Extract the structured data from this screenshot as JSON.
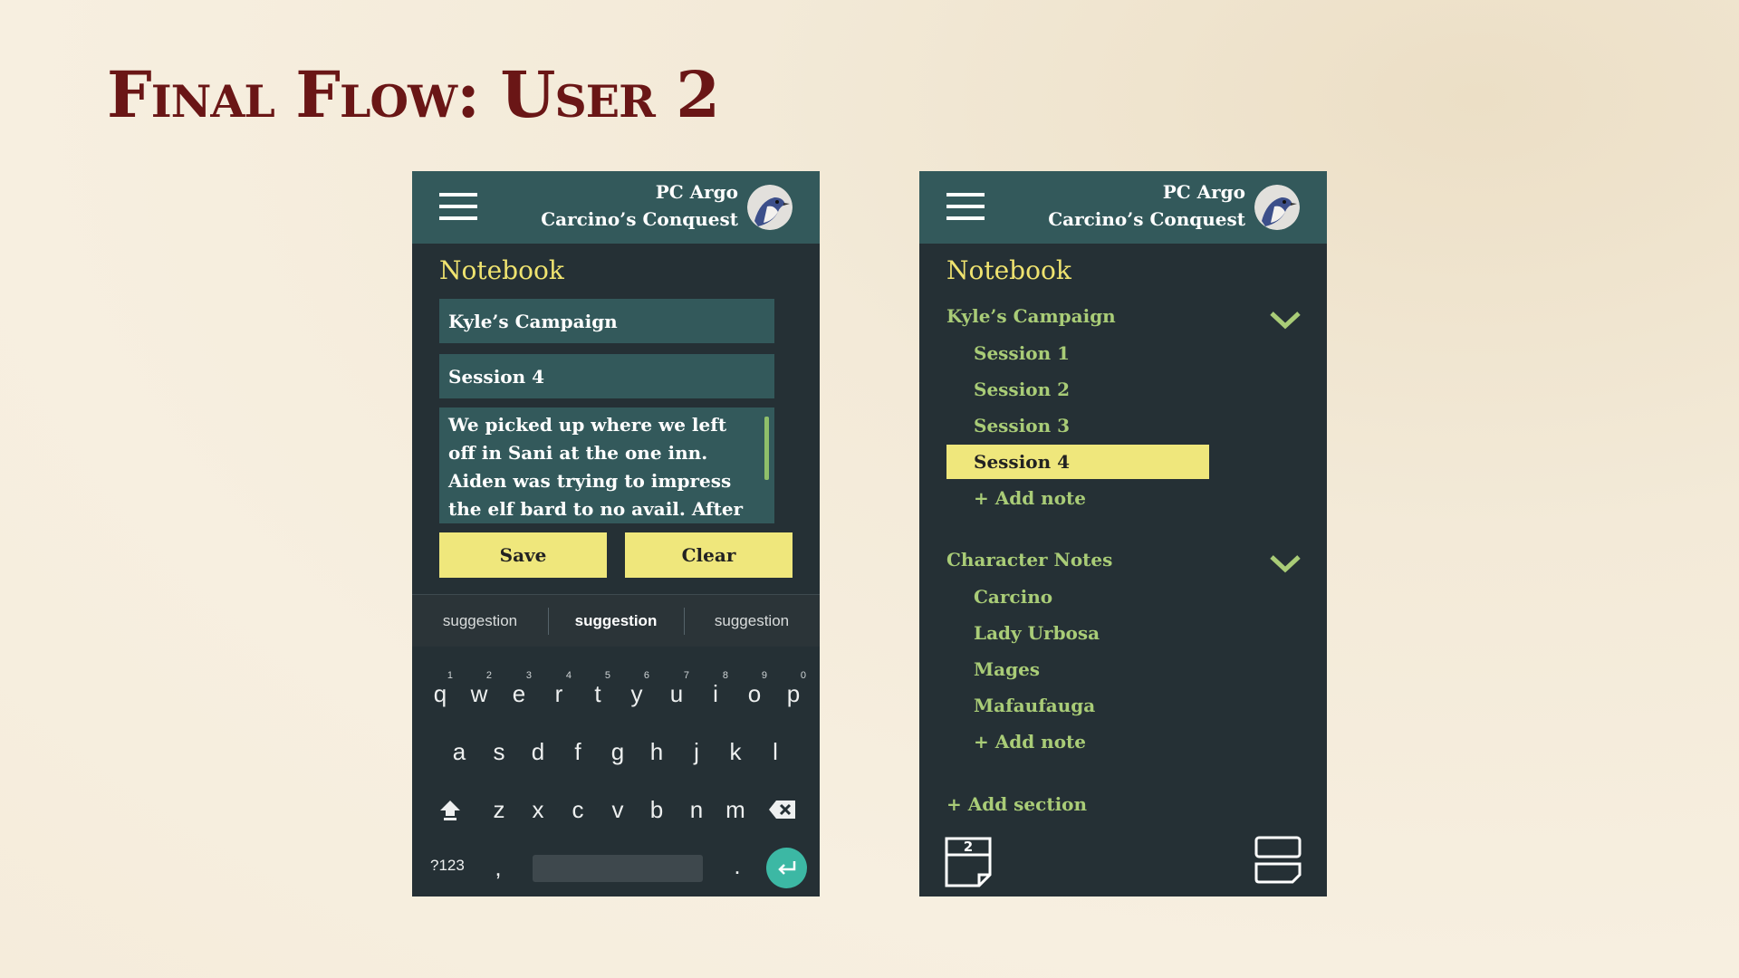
{
  "slide": {
    "title": "Final Flow: User 2"
  },
  "header": {
    "line1": "PC Argo",
    "line2": "Carcino’s Conquest"
  },
  "left_phone": {
    "notebook_title": "Notebook",
    "campaign_field": "Kyle’s Campaign",
    "session_field": "Session 4",
    "note_text": "We picked up where we left off in Sani at the one inn. Aiden was trying to impress the elf bard to no avail. After finishing up at",
    "save_label": "Save",
    "clear_label": "Clear",
    "suggestions": [
      "suggestion",
      "suggestion",
      "suggestion"
    ],
    "keyboard": {
      "row1": [
        "q",
        "w",
        "e",
        "r",
        "t",
        "y",
        "u",
        "i",
        "o",
        "p"
      ],
      "row1_hints": [
        "1",
        "2",
        "3",
        "4",
        "5",
        "6",
        "7",
        "8",
        "9",
        "0"
      ],
      "row2": [
        "a",
        "s",
        "d",
        "f",
        "g",
        "h",
        "j",
        "k",
        "l"
      ],
      "row3": [
        "z",
        "x",
        "c",
        "v",
        "b",
        "n",
        "m"
      ],
      "mode_label": "?123",
      "comma": ",",
      "period": "."
    }
  },
  "right_phone": {
    "notebook_title": "Notebook",
    "sections": [
      {
        "title": "Kyle’s Campaign",
        "items": [
          "Session 1",
          "Session 2",
          "Session 3",
          "Session 4"
        ],
        "active_index": 3,
        "add_label": "+ Add note"
      },
      {
        "title": "Character Notes",
        "items": [
          "Carcino",
          "Lady Urbosa",
          "Mages",
          "Mafaufauga"
        ],
        "add_label": "+ Add note"
      }
    ],
    "add_section_label": "+ Add section",
    "page_icon_number": "2"
  },
  "colors": {
    "header_teal": "#33595b",
    "panel_dark": "#253035",
    "accent_yellow": "#efe77c",
    "title_yellow": "#efe36f",
    "nav_green": "#a9cc77",
    "title_red": "#6a1616"
  },
  "icons": [
    "hamburger-icon",
    "avatar-bird",
    "chevron-down-icon",
    "shift-icon",
    "backspace-icon",
    "enter-icon",
    "page-icon",
    "split-view-icon"
  ]
}
